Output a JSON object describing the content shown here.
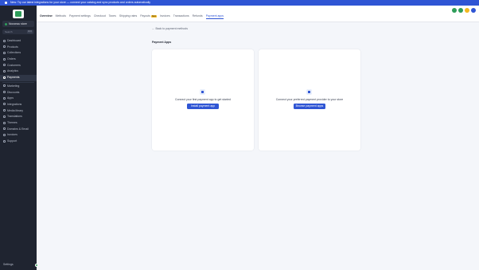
{
  "announcement": {
    "text": "New: Try our latest integrations for your store — connect your catalog and sync products and orders automatically"
  },
  "sidebar": {
    "store_name": "Nouveau store",
    "search_placeholder": "Search",
    "search_shortcut": "⌘ K",
    "items": [
      {
        "label": "Dashboard",
        "icon": "home-icon"
      },
      {
        "label": "Products",
        "icon": "box-icon"
      },
      {
        "label": "Collections",
        "icon": "folder-icon"
      },
      {
        "label": "Orders",
        "icon": "cart-icon"
      },
      {
        "label": "Customers",
        "icon": "users-icon"
      },
      {
        "label": "Analytics",
        "icon": "chart-icon"
      },
      {
        "label": "Payments",
        "icon": "card-icon",
        "active": true
      }
    ],
    "items2": [
      {
        "label": "Marketing",
        "icon": "megaphone-icon"
      },
      {
        "label": "Discounts",
        "icon": "tag-icon"
      },
      {
        "label": "Apps",
        "icon": "grid-icon"
      },
      {
        "label": "Integrations",
        "icon": "plug-icon"
      },
      {
        "label": "Media library",
        "icon": "image-icon"
      },
      {
        "label": "Translations",
        "icon": "globe-icon"
      },
      {
        "label": "Themes",
        "icon": "palette-icon"
      },
      {
        "label": "Domains & Email",
        "icon": "mail-icon"
      },
      {
        "label": "Invoices",
        "icon": "file-icon"
      },
      {
        "label": "Support",
        "icon": "help-icon"
      }
    ],
    "settings_label": "Settings"
  },
  "header": {
    "tabs": [
      {
        "label": "Overview"
      },
      {
        "label": "Methods"
      },
      {
        "label": "Payment settings"
      },
      {
        "label": "Checkout"
      },
      {
        "label": "Taxes"
      },
      {
        "label": "Shipping rates"
      },
      {
        "label": "Payouts",
        "badge": "New"
      },
      {
        "label": "Invoices"
      },
      {
        "label": "Transactions"
      },
      {
        "label": "Refunds"
      },
      {
        "label": "Payment apps",
        "active": true
      }
    ],
    "icon_colors": [
      "#2e9d5a",
      "#2e9d5a",
      "#f2b820",
      "#2f55d4"
    ]
  },
  "main": {
    "back_text": "← Back to payment methods",
    "section_title": "Payment Apps",
    "cards": [
      {
        "text": "Connect your first payment app to get started",
        "button": "Install payment app",
        "icon": "app-icon"
      },
      {
        "text": "Connect your preferred payment provider to your store",
        "button": "Browse payment apps",
        "icon": "provider-icon"
      }
    ]
  }
}
